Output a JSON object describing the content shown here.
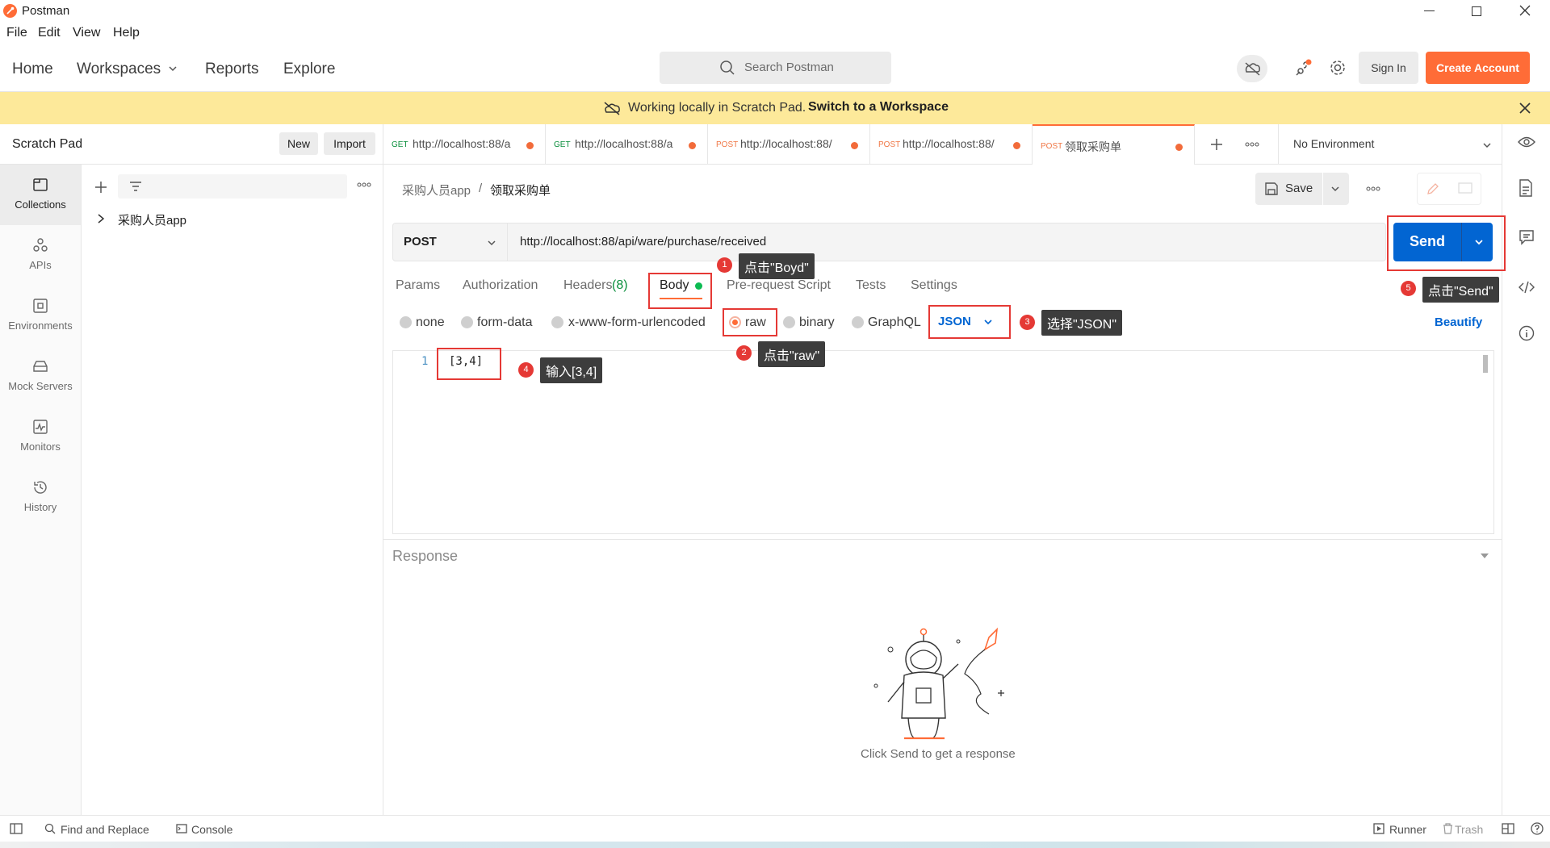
{
  "window": {
    "title": "Postman"
  },
  "menu": [
    "File",
    "Edit",
    "View",
    "Help"
  ],
  "header": {
    "nav": [
      "Home",
      "Workspaces",
      "Reports",
      "Explore"
    ],
    "search_placeholder": "Search Postman",
    "sign_in": "Sign In",
    "create_account": "Create Account"
  },
  "banner": {
    "text": "Working locally in Scratch Pad.",
    "link": "Switch to a Workspace"
  },
  "sidebar": {
    "title": "Scratch Pad",
    "new_btn": "New",
    "import_btn": "Import",
    "rail": [
      "Collections",
      "APIs",
      "Environments",
      "Mock Servers",
      "Monitors",
      "History"
    ],
    "collection": "采购人员app"
  },
  "tabs": [
    {
      "method": "GET",
      "label": "http://localhost:88/a"
    },
    {
      "method": "GET",
      "label": "http://localhost:88/a"
    },
    {
      "method": "POST",
      "label": "http://localhost:88/"
    },
    {
      "method": "POST",
      "label": "http://localhost:88/"
    },
    {
      "method": "POST",
      "label": "领取采购单"
    }
  ],
  "environment": "No Environment",
  "breadcrumb": {
    "parent": "采购人员app",
    "separator": "/",
    "current": "领取采购单"
  },
  "save_label": "Save",
  "request": {
    "method": "POST",
    "url": "http://localhost:88/api/ware/purchase/received",
    "send": "Send"
  },
  "subtabs": {
    "params": "Params",
    "authorization": "Authorization",
    "headers": "Headers",
    "headers_count": "(8)",
    "body": "Body",
    "prerequest": "Pre-request Script",
    "tests": "Tests",
    "settings": "Settings"
  },
  "body_types": [
    "none",
    "form-data",
    "x-www-form-urlencoded",
    "raw",
    "binary",
    "GraphQL"
  ],
  "format": "JSON",
  "beautify": "Beautify",
  "editor": {
    "line": "1",
    "content": "[3,4]"
  },
  "annotations": [
    {
      "n": "1",
      "text": "点击\"Boyd\""
    },
    {
      "n": "2",
      "text": "点击\"raw\""
    },
    {
      "n": "3",
      "text": "选择\"JSON\""
    },
    {
      "n": "4",
      "text": "输入[3,4]"
    },
    {
      "n": "5",
      "text": "点击\"Send\""
    }
  ],
  "response": {
    "title": "Response",
    "empty": "Click Send to get a response"
  },
  "statusbar": {
    "find": "Find and Replace",
    "console": "Console",
    "runner": "Runner",
    "trash": "Trash"
  },
  "colors": {
    "accent": "#ff6c37",
    "send": "#0265d2",
    "banner": "#fde99a",
    "annotation": "#e53935"
  }
}
